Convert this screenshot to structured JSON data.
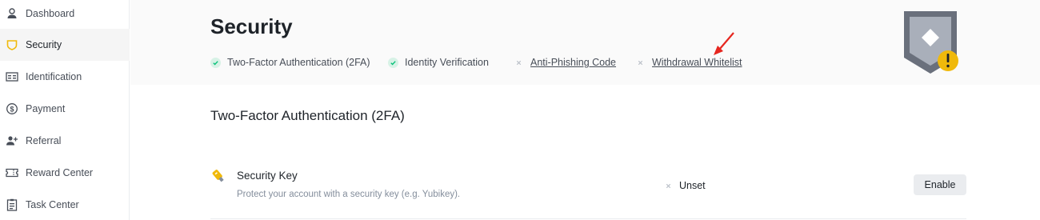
{
  "sidebar": {
    "items": [
      {
        "label": "Dashboard",
        "icon": "user-icon"
      },
      {
        "label": "Security",
        "icon": "shield-icon",
        "active": true
      },
      {
        "label": "Identification",
        "icon": "id-card-icon"
      },
      {
        "label": "Payment",
        "icon": "dollar-icon"
      },
      {
        "label": "Referral",
        "icon": "add-user-icon"
      },
      {
        "label": "Reward Center",
        "icon": "ticket-icon"
      },
      {
        "label": "Task Center",
        "icon": "checklist-icon"
      }
    ]
  },
  "header": {
    "title": "Security",
    "status": [
      {
        "label": "Two-Factor Authentication (2FA)",
        "state": "ok"
      },
      {
        "label": "Identity Verification",
        "state": "ok"
      },
      {
        "label": "Anti-Phishing Code",
        "state": "unset"
      },
      {
        "label": "Withdrawal Whitelist",
        "state": "unset"
      }
    ]
  },
  "main": {
    "section_title": "Two-Factor Authentication (2FA)",
    "security_key": {
      "title": "Security Key",
      "description": "Protect your account with a security key (e.g. Yubikey).",
      "status": "Unset",
      "button": "Enable"
    }
  },
  "colors": {
    "accent": "#f0b90b",
    "ok": "#02c076",
    "muted": "#848e9c",
    "annotation_arrow": "#e6261f"
  }
}
